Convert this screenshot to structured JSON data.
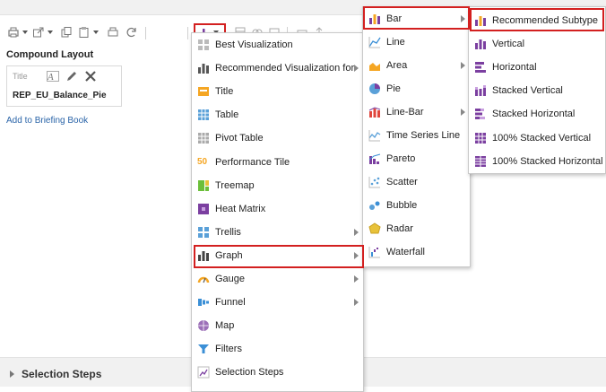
{
  "compound_layout": {
    "title": "Compound Layout",
    "view_caption": "Title",
    "view_name": "REP_EU_Balance_Pie",
    "add_to_briefing": "Add to Briefing Book"
  },
  "menu1": {
    "items": [
      {
        "label": "Best Visualization",
        "icon": "best-visualization-icon",
        "submenu": false
      },
      {
        "label": "Recommended Visualization for",
        "icon": "recommended-visualization-icon",
        "submenu": true
      },
      {
        "label": "Title",
        "icon": "title-icon",
        "submenu": false
      },
      {
        "label": "Table",
        "icon": "table-icon",
        "submenu": false
      },
      {
        "label": "Pivot Table",
        "icon": "pivot-table-icon",
        "submenu": false
      },
      {
        "label": "Performance Tile",
        "icon": "performance-tile-icon",
        "submenu": false
      },
      {
        "label": "Treemap",
        "icon": "treemap-icon",
        "submenu": false
      },
      {
        "label": "Heat Matrix",
        "icon": "heat-matrix-icon",
        "submenu": false
      },
      {
        "label": "Trellis",
        "icon": "trellis-icon",
        "submenu": true
      },
      {
        "label": "Graph",
        "icon": "graph-icon",
        "submenu": true
      },
      {
        "label": "Gauge",
        "icon": "gauge-icon",
        "submenu": true
      },
      {
        "label": "Funnel",
        "icon": "funnel-icon",
        "submenu": true
      },
      {
        "label": "Map",
        "icon": "map-icon",
        "submenu": false
      },
      {
        "label": "Filters",
        "icon": "filters-icon",
        "submenu": false
      },
      {
        "label": "Selection Steps",
        "icon": "selection-steps-icon",
        "submenu": false
      }
    ],
    "performance_tile_icon_text": "50"
  },
  "menu2": {
    "items": [
      {
        "label": "Bar",
        "icon": "bar-chart-icon",
        "submenu": true
      },
      {
        "label": "Line",
        "icon": "line-chart-icon",
        "submenu": false
      },
      {
        "label": "Area",
        "icon": "area-chart-icon",
        "submenu": true
      },
      {
        "label": "Pie",
        "icon": "pie-chart-icon",
        "submenu": false
      },
      {
        "label": "Line-Bar",
        "icon": "line-bar-icon",
        "submenu": true
      },
      {
        "label": "Time Series Line",
        "icon": "time-series-icon",
        "submenu": false
      },
      {
        "label": "Pareto",
        "icon": "pareto-icon",
        "submenu": false
      },
      {
        "label": "Scatter",
        "icon": "scatter-icon",
        "submenu": false
      },
      {
        "label": "Bubble",
        "icon": "bubble-icon",
        "submenu": false
      },
      {
        "label": "Radar",
        "icon": "radar-icon",
        "submenu": false
      },
      {
        "label": "Waterfall",
        "icon": "waterfall-icon",
        "submenu": false
      }
    ]
  },
  "menu3": {
    "items": [
      {
        "label": "Recommended Subtype",
        "icon": "recommended-subtype-icon"
      },
      {
        "label": "Vertical",
        "icon": "vertical-bar-icon"
      },
      {
        "label": "Horizontal",
        "icon": "horizontal-bar-icon"
      },
      {
        "label": "Stacked Vertical",
        "icon": "stacked-vertical-icon"
      },
      {
        "label": "Stacked Horizontal",
        "icon": "stacked-horizontal-icon"
      },
      {
        "label": "100% Stacked Vertical",
        "icon": "100-stacked-vertical-icon"
      },
      {
        "label": "100% Stacked Horizontal",
        "icon": "100-stacked-horizontal-icon"
      }
    ]
  },
  "bottom": {
    "section_label": "Selection Steps"
  },
  "colors": {
    "highlight_border": "#d32020",
    "link": "#2a64a8",
    "bar_purple": "#7b3fa0",
    "accent_orange": "#f5a623",
    "accent_blue": "#3b8fd6"
  }
}
